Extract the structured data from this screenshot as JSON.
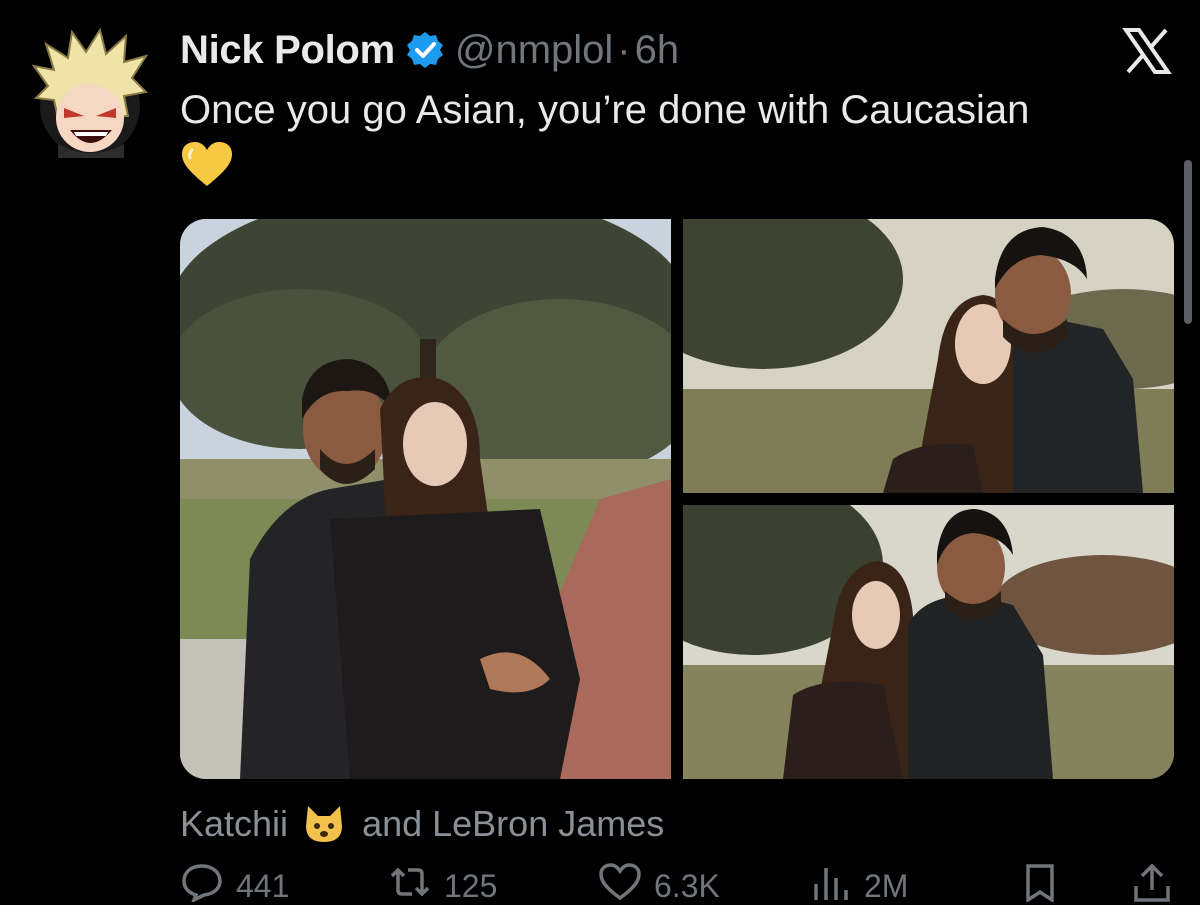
{
  "tweet": {
    "author_name": "Nick Polom",
    "handle": "@nmplol",
    "separator": "·",
    "time": "6h",
    "text": "Once you go Asian, you’re done with Caucasian",
    "emoji": "yellow-heart"
  },
  "media": {
    "count": 3
  },
  "liked_by": {
    "first": "Katchii",
    "rest": "and LeBron James"
  },
  "stats": {
    "replies": "441",
    "reposts": "125",
    "likes": "6.3K",
    "views": "2M"
  },
  "colors": {
    "background": "#000000",
    "text": "#e7e9ea",
    "muted": "#71767b",
    "verified": "#1d9bf0"
  },
  "icons": [
    "x-logo-icon",
    "verified-badge-icon",
    "reply-icon",
    "repost-icon",
    "like-icon",
    "views-icon",
    "bookmark-icon",
    "share-icon"
  ]
}
